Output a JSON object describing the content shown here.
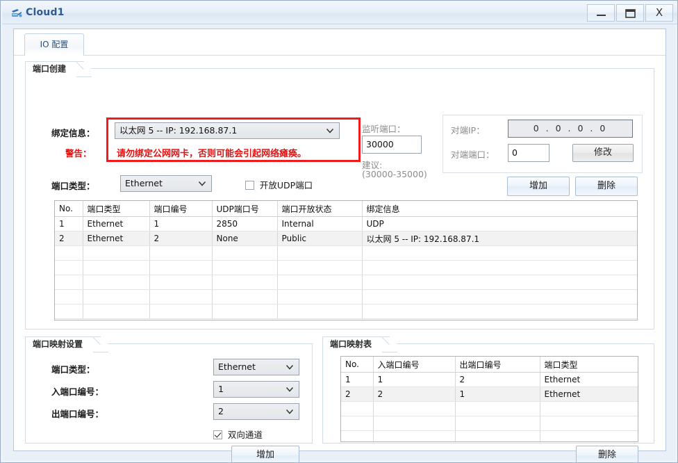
{
  "window": {
    "title": "Cloud1",
    "icon": "cloud-network-icon",
    "minimize_label": "–",
    "maximize_label": "□",
    "close_label": "X"
  },
  "tabs": [
    {
      "label": "IO 配置",
      "name": "tab-io-config",
      "selected": true
    }
  ],
  "port_create": {
    "group_title": "端口创建",
    "binding_label": "绑定信息：",
    "binding_value": "以太网 5 -- IP: 192.168.87.1",
    "warning_label": "警告：",
    "warning_text": "请勿绑定公网网卡，否则可能会引起网络瘫痪。",
    "warning_color": "#ee1c1c",
    "port_type_label": "端口类型：",
    "port_type_value": "Ethernet",
    "udp_checkbox_label": "开放UDP端口",
    "udp_checkbox_checked": false,
    "listen_port_label": "监听端口：",
    "listen_port_value": "30000",
    "suggest_label": "建议:",
    "suggest_range": "(30000-35000)",
    "peer_ip_label": "对端IP：",
    "peer_ip_value": "0 . 0 . 0 . 0",
    "peer_port_label": "对端端口：",
    "peer_port_value": "0",
    "modify_button": "修改",
    "add_button": "增加",
    "delete_button": "删除"
  },
  "port_table": {
    "columns": [
      "No.",
      "端口类型",
      "端口编号",
      "UDP端口号",
      "端口开放状态",
      "绑定信息"
    ],
    "rows": [
      [
        "1",
        "Ethernet",
        "1",
        "2850",
        "Internal",
        "UDP"
      ],
      [
        "2",
        "Ethernet",
        "2",
        "None",
        "Public",
        "以太网 5 -- IP: 192.168.87.1"
      ]
    ],
    "empty_rows": 4
  },
  "mapping_settings": {
    "group_title": "端口映射设置",
    "port_type_label": "端口类型：",
    "port_type_value": "Ethernet",
    "in_port_label": "入端口编号：",
    "in_port_value": "1",
    "out_port_label": "出端口编号：",
    "out_port_value": "2",
    "bidirectional_label": "双向通道",
    "bidirectional_checked": true,
    "add_button": "增加"
  },
  "mapping_table": {
    "group_title": "端口映射表",
    "columns": [
      "No.",
      "入端口编号",
      "出端口编号",
      "端口类型"
    ],
    "rows": [
      [
        "1",
        "1",
        "2",
        "Ethernet"
      ],
      [
        "2",
        "2",
        "1",
        "Ethernet"
      ]
    ],
    "empty_rows": 3,
    "delete_button": "删除"
  },
  "colors": {
    "title_text": "#2d5b92",
    "warning": "#ee1c1c",
    "window_bg": "#eaf0f8",
    "client_bg": "#ffffff"
  }
}
